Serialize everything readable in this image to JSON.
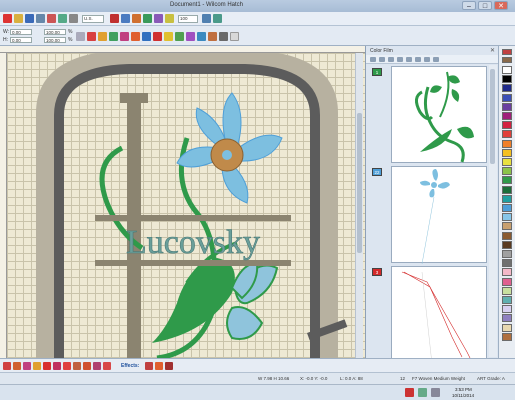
{
  "window": {
    "title": "Document1 - Wilcom Hatch",
    "minimize": "–",
    "maximize": "□",
    "close": "✕"
  },
  "toolbar": {
    "unit_select": "U.S.",
    "zoom": "100"
  },
  "props": {
    "w_label": "W:",
    "w_value": "0.00",
    "h_label": "H:",
    "h_value": "0.00",
    "w_pct": "100.00",
    "h_pct": "100.00",
    "pct_unit": "%"
  },
  "canvas": {
    "lettering": "Lucovsky"
  },
  "color_film": {
    "title": "Color Film",
    "close": "✕",
    "items": [
      {
        "number": "1",
        "color": "#2f9a4a"
      },
      {
        "number": "22",
        "color": "#4e9fd8"
      },
      {
        "number": "3",
        "color": "#d42a2a"
      }
    ]
  },
  "palette": {
    "colors": [
      "#ffffff",
      "#000000",
      "#1f2a8a",
      "#3b4fb8",
      "#6a3fa0",
      "#a0207a",
      "#d32040",
      "#e0403a",
      "#f07f2a",
      "#f4c020",
      "#e8e040",
      "#8bc34a",
      "#2f9a4a",
      "#1b6e3a",
      "#20a0a0",
      "#4e9fd8",
      "#87c6e8",
      "#c8a070",
      "#8a5a30",
      "#5a3a20",
      "#a0a0a0",
      "#707070",
      "#f4b8c8",
      "#e06090",
      "#c8e0a0",
      "#60b0b0",
      "#d8d0f0",
      "#9080c0",
      "#e8d8b0",
      "#b07040"
    ],
    "tools": [
      "thread-icon",
      "pin-icon"
    ]
  },
  "bottom": {
    "effects_label": "Effects:"
  },
  "status": {
    "size": "W 7.98  H 10.66",
    "coords": "X: -0.0 Y: -0.0",
    "angle": "L: 0.0  A: 88",
    "stitch_count": "12",
    "fabric": "F7 Woven Medium Weight",
    "art_grade": "ART Grade: A"
  },
  "taskbar": {
    "time": "3:53 PM",
    "date": "10/11/2014"
  }
}
